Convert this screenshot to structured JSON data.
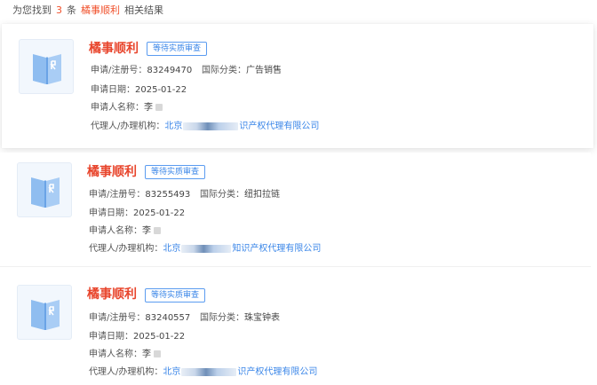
{
  "summary": {
    "prefix": "为您找到",
    "count": "3",
    "unit": "条",
    "keyword": "橘事顺利",
    "suffix": "相关结果"
  },
  "labels": {
    "reg_no": "申请/注册号：",
    "intl_class": "国际分类：",
    "apply_date": "申请日期：",
    "applicant": "申请人名称：",
    "agent": "代理人/办理机构："
  },
  "icons": {
    "thumbnail": "book-icon"
  },
  "colors": {
    "title": "#e8452c",
    "accent": "#3a86e8",
    "highlight": "#f0502b"
  },
  "results": [
    {
      "title": "橘事顺利",
      "status": "等待实质审查",
      "reg_no": "83249470",
      "intl_class": "广告销售",
      "apply_date": "2025-01-22",
      "applicant": "李",
      "agent_start": "北京",
      "agent_end": "识产权代理有限公司"
    },
    {
      "title": "橘事顺利",
      "status": "等待实质审查",
      "reg_no": "83255493",
      "intl_class": "纽扣拉链",
      "apply_date": "2025-01-22",
      "applicant": "李",
      "agent_start": "北京",
      "agent_end": "知识产权代理有限公司"
    },
    {
      "title": "橘事顺利",
      "status": "等待实质审查",
      "reg_no": "83240557",
      "intl_class": "珠宝钟表",
      "apply_date": "2025-01-22",
      "applicant": "李",
      "agent_start": "北京",
      "agent_end": "识产权代理有限公司"
    }
  ]
}
